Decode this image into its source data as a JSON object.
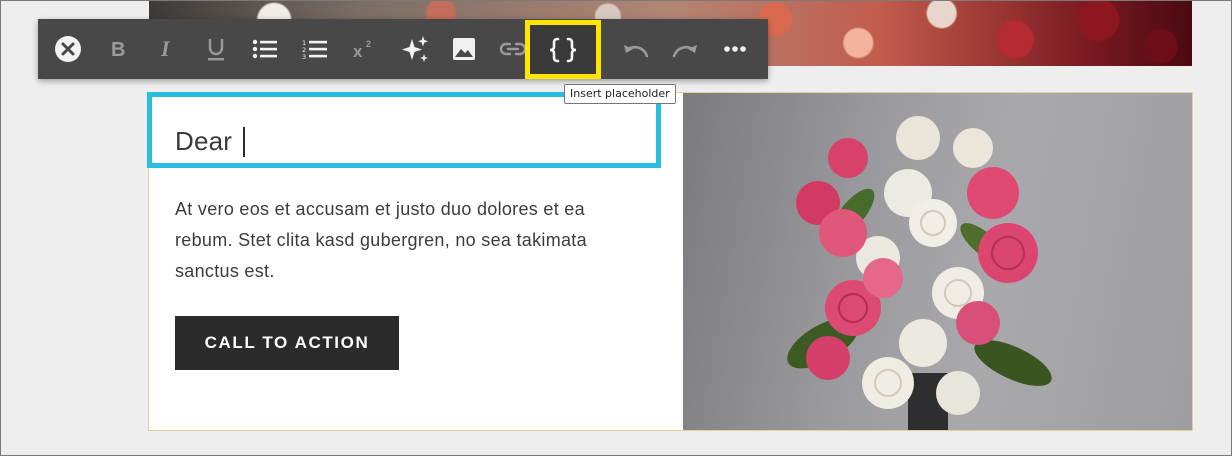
{
  "editor": {
    "heading_text": "Dear",
    "body_text": "At vero eos et accusam et justo duo dolores et ea rebum. Stet clita kasd gubergren, no sea takimata sanctus est.",
    "cta_label": "CALL TO ACTION"
  },
  "toolbar": {
    "tooltip_text": "Insert placeholder",
    "highlight_color": "#ffe500",
    "buttons": [
      {
        "name": "close-icon",
        "state": "enabled"
      },
      {
        "name": "bold-icon",
        "state": "disabled"
      },
      {
        "name": "italic-icon",
        "state": "disabled"
      },
      {
        "name": "underline-icon",
        "state": "disabled"
      },
      {
        "name": "bullet-list-icon",
        "state": "enabled"
      },
      {
        "name": "numbered-list-icon",
        "state": "enabled"
      },
      {
        "name": "superscript-icon",
        "state": "disabled"
      },
      {
        "name": "ai-sparkle-icon",
        "state": "enabled"
      },
      {
        "name": "image-icon",
        "state": "enabled"
      },
      {
        "name": "link-icon",
        "state": "disabled"
      },
      {
        "name": "insert-placeholder-icon",
        "state": "highlighted"
      },
      {
        "name": "undo-icon",
        "state": "disabled"
      },
      {
        "name": "redo-icon",
        "state": "disabled"
      },
      {
        "name": "more-options-icon",
        "state": "enabled"
      }
    ]
  },
  "colors": {
    "selection_border": "#29bde0",
    "toolbar_bg": "#484848",
    "cta_bg": "#2b2b2b"
  }
}
